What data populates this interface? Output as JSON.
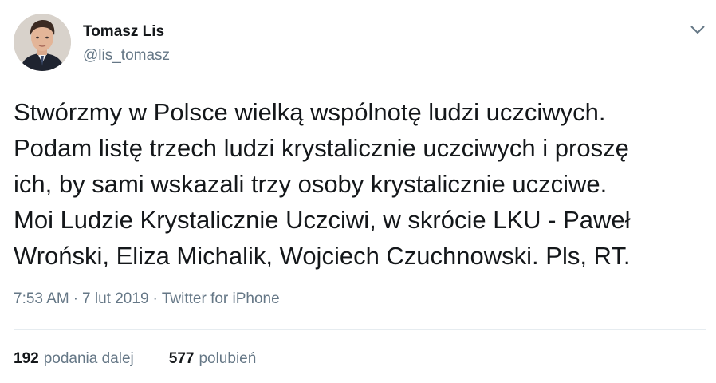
{
  "author": {
    "name": "Tomasz Lis",
    "handle": "@lis_tomasz"
  },
  "tweet": {
    "lines": [
      "Stwórzmy w Polsce wielką wspólnotę ludzi uczciwych.",
      "Podam listę trzech ludzi krystalicznie uczciwych i proszę",
      "ich, by sami wskazali trzy osoby krystalicznie uczciwe.",
      "Moi Ludzie Krystalicznie Uczciwi, w skrócie LKU - Paweł",
      "Wroński, Eliza Michalik, Wojciech Czuchnowski. Pls, RT."
    ]
  },
  "meta": {
    "time": "7:53 AM",
    "date": "7 lut 2019",
    "separator": "·",
    "source": "Twitter for iPhone"
  },
  "stats": {
    "retweets_count": "192",
    "retweets_label": "podania dalej",
    "likes_count": "577",
    "likes_label": "polubień"
  },
  "icons": {
    "menu": "chevron-down-icon"
  },
  "colors": {
    "text": "#14171a",
    "secondary": "#657786",
    "divider": "#e6ecf0",
    "background": "#ffffff"
  }
}
